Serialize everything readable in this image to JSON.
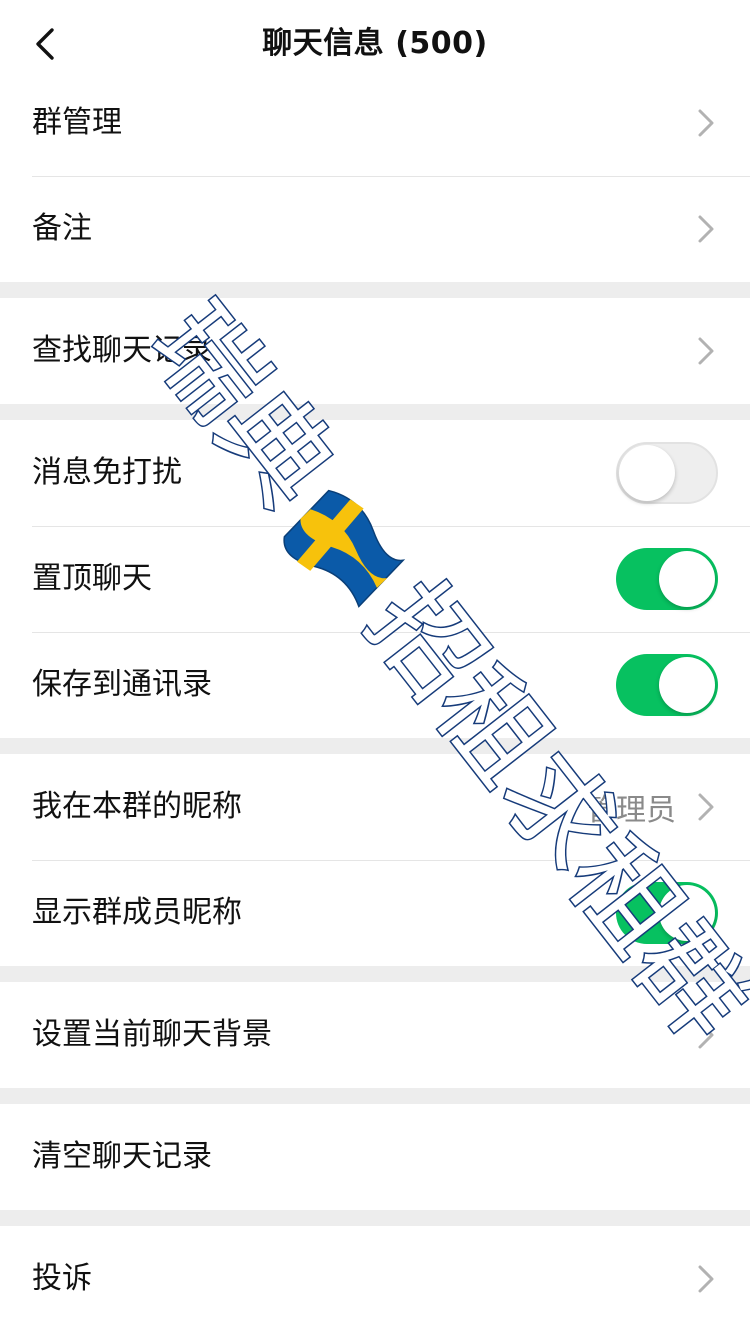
{
  "header": {
    "title": "聊天信息 (500)"
  },
  "groups": [
    [
      {
        "label": "群管理",
        "control": "chevron"
      },
      {
        "label": "备注",
        "control": "chevron"
      }
    ],
    [
      {
        "label": "查找聊天记录",
        "control": "chevron"
      }
    ],
    [
      {
        "label": "消息免打扰",
        "control": "switch",
        "on": false
      },
      {
        "label": "置顶聊天",
        "control": "switch",
        "on": true
      },
      {
        "label": "保存到通讯录",
        "control": "switch",
        "on": true
      }
    ],
    [
      {
        "label": "我在本群的昵称",
        "control": "chevron",
        "value": "管理员"
      },
      {
        "label": "显示群成员昵称",
        "control": "switch",
        "on": true
      }
    ],
    [
      {
        "label": "设置当前聊天背景",
        "control": "chevron"
      }
    ],
    [
      {
        "label": "清空聊天记录",
        "control": "none"
      }
    ],
    [
      {
        "label": "投诉",
        "control": "chevron"
      }
    ]
  ],
  "watermark": {
    "text": "瑞典招租求租群",
    "flag_icon": "sweden-flag-icon",
    "colors": {
      "fill": "#ffffff",
      "outline": "#163b7a"
    }
  },
  "colors": {
    "switch_on": "#07c160",
    "background": "#ededed"
  }
}
